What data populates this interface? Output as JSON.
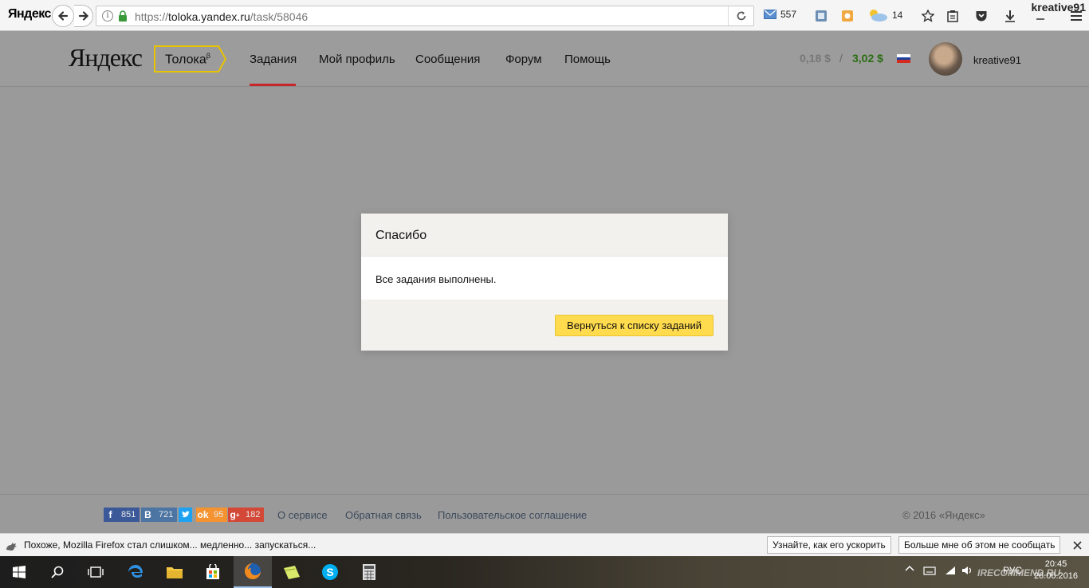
{
  "browser": {
    "logo": "Яндекс",
    "url_prefix": "https://",
    "url_host": "toloka.yandex.ru",
    "url_path": "/task/58046",
    "mail_count": "557",
    "weather_temp": "14",
    "user": "kreative91"
  },
  "header": {
    "logo": "Яндекс",
    "service": "Толока",
    "service_sup": "β",
    "nav": [
      "Задания",
      "Мой профиль",
      "Сообщения",
      "Форум",
      "Помощь"
    ],
    "balance_pending": "0,18 $",
    "balance_separator": "/",
    "balance_available": "3,02 $",
    "username": "kreative91",
    "colors": {
      "balance_available": "#2a6d12",
      "active_tab_underline": "#c8262a"
    }
  },
  "modal": {
    "title": "Спасибо",
    "message": "Все задания выполнены.",
    "button": "Вернуться к списку заданий",
    "colors": {
      "button": "#ffdb4d"
    }
  },
  "footer": {
    "social": [
      {
        "icon": "facebook-icon",
        "count": "851",
        "color": "#3b5998"
      },
      {
        "icon": "vk-icon",
        "count": "721",
        "color": "#4c75a3"
      },
      {
        "icon": "twitter-icon",
        "count": "",
        "color": "#1da1f2"
      },
      {
        "icon": "odnoklassniki-icon",
        "count": "95",
        "color": "#f59331"
      },
      {
        "icon": "google-plus-icon",
        "count": "182",
        "color": "#d34836"
      }
    ],
    "links": [
      "О сервисе",
      "Обратная связь",
      "Пользовательское соглашение"
    ],
    "copyright": "© 2016 «Яндекс»"
  },
  "notification": {
    "text": "Похоже, Mozilla Firefox стал слишком... медленно... запускаться...",
    "learn_button": "Узнайте, как его ускорить",
    "dismiss_button": "Больше мне об этом не сообщать"
  },
  "taskbar": {
    "time": "20:45",
    "date": "26.06.2016",
    "language": "РУС",
    "watermark": "IRECOMMEND.RU"
  }
}
